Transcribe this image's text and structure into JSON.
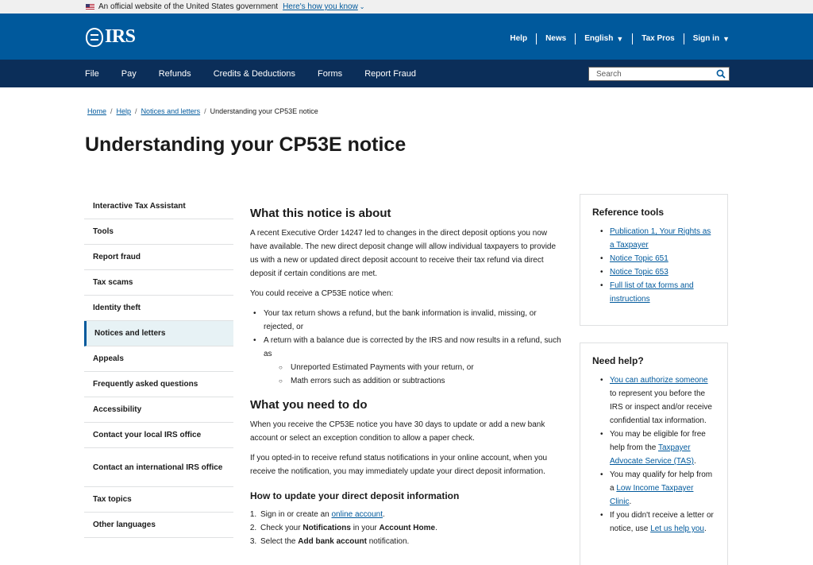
{
  "gov_banner": {
    "text": "An official website of the United States government",
    "link": "Here's how you know"
  },
  "header": {
    "logo_text": "IRS",
    "utility_nav": [
      "Help",
      "News",
      "English",
      "Tax Pros",
      "Sign in"
    ]
  },
  "main_nav": {
    "items": [
      "File",
      "Pay",
      "Refunds",
      "Credits & Deductions",
      "Forms",
      "Report Fraud"
    ],
    "search_placeholder": "Search"
  },
  "breadcrumb": {
    "items": [
      "Home",
      "Help",
      "Notices and letters"
    ],
    "current": "Understanding your CP53E notice"
  },
  "page_title": "Understanding your CP53E notice",
  "sidebar": {
    "items": [
      "Interactive Tax Assistant",
      "Tools",
      "Report fraud",
      "Tax scams",
      "Identity theft",
      "Notices and letters",
      "Appeals",
      "Frequently asked questions",
      "Accessibility",
      "Contact your local IRS office",
      "Contact an international IRS office",
      "Tax topics",
      "Other languages"
    ],
    "active_index": 5
  },
  "content": {
    "section1_title": "What this notice is about",
    "section1_p1": "A recent Executive Order 14247 led to changes in the direct deposit options you now have available. The new direct deposit change will allow individual taxpayers to provide us with a new or updated direct deposit account to receive their tax refund via direct deposit if certain conditions are met.",
    "section1_p2": "You could receive a CP53E notice when:",
    "bullet1": "Your tax return shows a refund, but the bank information is invalid, missing, or rejected, or",
    "bullet2": "A return with a balance due is corrected by the IRS and now results in a refund, such as",
    "sub1": "Unreported Estimated Payments with your return, or",
    "sub2": "Math errors such as addition or subtractions",
    "section2_title": "What you need to do",
    "section2_p1": "When you receive the CP53E notice you have 30 days to update or add a new bank account or select an exception condition to allow a paper check.",
    "section2_p2": "If you opted-in to receive refund status notifications in your online account, when you receive the notification, you may immediately update your direct deposit information.",
    "section3_title": "How to update your direct deposit information",
    "step1_pre": "Sign in or create an ",
    "step1_link": "online account",
    "step1_post": ".",
    "step2_pre": "Check your ",
    "step2_b1": "Notifications",
    "step2_mid": " in your ",
    "step2_b2": "Account Home",
    "step2_post": ".",
    "step3_pre": "Select the ",
    "step3_b": "Add bank account",
    "step3_post": " notification."
  },
  "reference_tools": {
    "title": "Reference tools",
    "links": [
      "Publication 1, Your Rights as a Taxpayer",
      "Notice Topic 651",
      "Notice Topic 653",
      "Full list of tax forms and instructions"
    ]
  },
  "need_help": {
    "title": "Need help?",
    "item1_link": "You can authorize someone",
    "item1_text": " to represent you before the IRS or inspect and/or receive confidential tax information.",
    "item2_text": "You may be eligible for free help from the ",
    "item2_link": "Taxpayer Advocate Service (TAS)",
    "item2_post": ".",
    "item3_text": "You may qualify for help from a ",
    "item3_link": "Low Income Taxpayer Clinic",
    "item3_post": ".",
    "item4_text": "If you didn't receive a letter or notice, use ",
    "item4_link": "Let us help you",
    "item4_post": "."
  },
  "colors": {
    "header_blue": "#00599c",
    "nav_navy": "#0b2e59",
    "link": "#00599c"
  }
}
